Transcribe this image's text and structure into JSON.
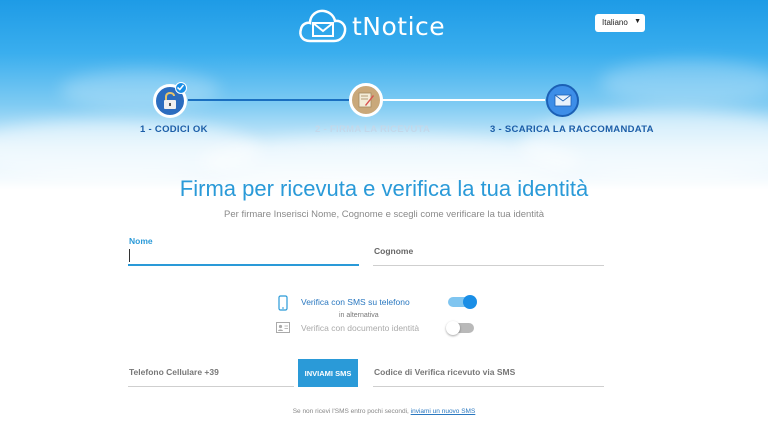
{
  "header": {
    "logo_text": "tNotice",
    "language": "Italiano"
  },
  "steps": [
    {
      "label": "1 - CODICI OK",
      "state": "done"
    },
    {
      "label": "2 - FIRMA LA RICEVUTA",
      "state": "active"
    },
    {
      "label": "3 - SCARICA LA RACCOMANDATA",
      "state": "pending"
    }
  ],
  "main": {
    "title": "Firma per ricevuta e verifica la tua identità",
    "subtitle": "Per firmare Inserisci Nome, Cognome e scegli come verificare la tua identità",
    "nome_label": "Nome",
    "nome_value": "",
    "cognome_label": "Cognome",
    "cognome_value": ""
  },
  "verification": {
    "option_sms": "Verifica con SMS su telefono",
    "or_text": "in alternativa",
    "option_document": "Verifica con documento identità",
    "sms_enabled": true,
    "document_enabled": false
  },
  "sms": {
    "phone_label": "Telefono Cellulare +39",
    "send_button": "INVIAMI SMS",
    "code_label": "Codice di Verifica ricevuto via SMS"
  },
  "footer": {
    "text": "Se non ricevi l'SMS entro pochi secondi,",
    "link": "inviami un nuovo SMS"
  },
  "colors": {
    "accent": "#2a9ad8",
    "step_done": "#1c5ea8"
  }
}
